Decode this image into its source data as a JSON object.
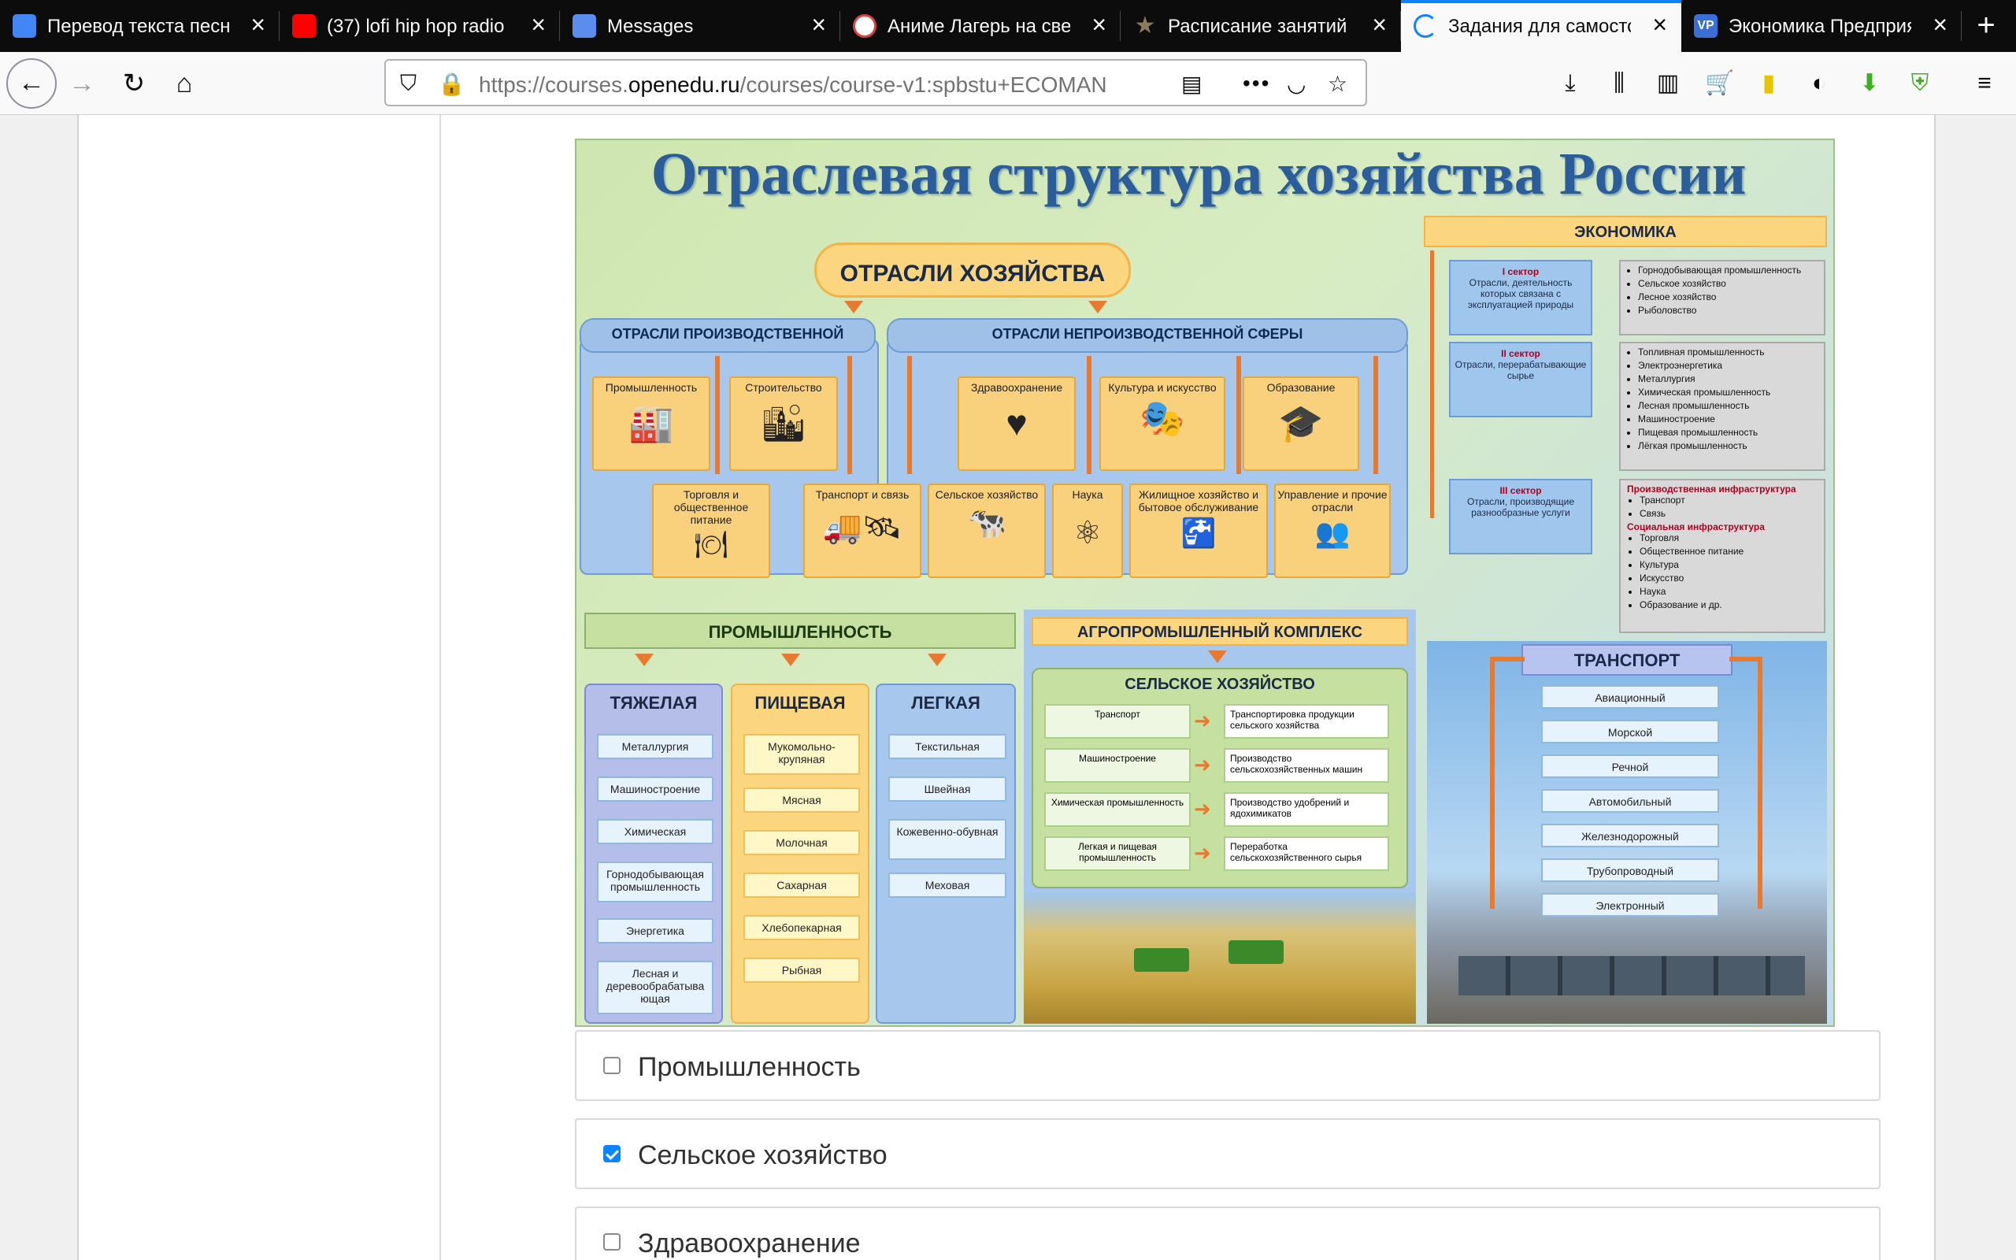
{
  "browser": {
    "tabs": [
      {
        "title": "Перевод текста песни",
        "icon": "docs-icon",
        "color": "#4285f4"
      },
      {
        "title": "(37) lofi hip hop radio",
        "icon": "youtube-icon",
        "color": "#ff0000"
      },
      {
        "title": "Messages",
        "icon": "messages-icon",
        "color": "#5b8def"
      },
      {
        "title": "Аниме Лагерь на свеж",
        "icon": "anime-icon",
        "color": "#e04040"
      },
      {
        "title": "Расписание занятий",
        "icon": "star-icon",
        "color": "#8a7b5a"
      },
      {
        "title": "Задания для самосто",
        "icon": "loading-icon",
        "color": "#0a84ff",
        "active": true
      },
      {
        "title": "Экономика Предприя",
        "icon": "vp-icon",
        "color": "#3a6fd8"
      }
    ],
    "url_prefix": "https://courses.",
    "url_domain": "openedu.ru",
    "url_rest": "/courses/course-v1:spbstu+ECOMAN"
  },
  "infographic": {
    "title": "Отраслевая структура хозяйства России",
    "main_node": "ОТРАСЛИ ХОЗЯЙСТВА",
    "prod_sphere": "ОТРАСЛИ ПРОИЗВОДСТВЕННОЙ",
    "nonprod_sphere": "ОТРАСЛИ НЕПРОИЗВОДСТВЕННОЙ СФЕРЫ",
    "branches_top": [
      "Промышленность",
      "Строительство",
      "Здравоохранение",
      "Культура и искусство",
      "Образование"
    ],
    "branches_bottom": [
      "Торговля и общественное питание",
      "Транспорт и связь",
      "Сельское хозяйство",
      "Наука",
      "Жилищное хозяйство и бытовое обслуживание",
      "Управление и прочие отрасли"
    ],
    "economy": {
      "title": "ЭКОНОМИКА",
      "sectors": [
        {
          "name": "I сектор",
          "desc": "Отрасли, деятельность которых связана с эксплуатацией природы",
          "items": [
            "Горнодобывающая промышленность",
            "Сельское хозяйство",
            "Лесное хозяйство",
            "Рыболовство"
          ]
        },
        {
          "name": "II сектор",
          "desc": "Отрасли, перерабатывающие сырье",
          "items": [
            "Топливная промышленность",
            "Электроэнергетика",
            "Металлургия",
            "Химическая промышленность",
            "Лесная промышленность",
            "Машиностроение",
            "Пищевая промышленность",
            "Лёгкая промышленность"
          ]
        },
        {
          "name": "III сектор",
          "desc": "Отрасли, производящие разнообразные услуги",
          "infra1": "Производственная инфраструктура",
          "items1": [
            "Транспорт",
            "Связь"
          ],
          "infra2": "Социальная инфраструктура",
          "items2": [
            "Торговля",
            "Общественное питание",
            "Культура",
            "Искусство",
            "Наука",
            "Образование и др."
          ]
        }
      ]
    },
    "industry": {
      "title": "ПРОМЫШЛЕННОСТЬ",
      "heavy": {
        "title": "ТЯЖЕЛАЯ",
        "items": [
          "Металлургия",
          "Машиностроение",
          "Химическая",
          "Горнодобывающая промышленность",
          "Энергетика",
          "Лесная и деревообрабатыва ющая"
        ]
      },
      "food": {
        "title": "ПИЩЕВАЯ",
        "items": [
          "Мукомольно-крупяная",
          "Мясная",
          "Молочная",
          "Сахарная",
          "Хлебопекарная",
          "Рыбная"
        ]
      },
      "light": {
        "title": "ЛЕГКАЯ",
        "items": [
          "Текстильная",
          "Швейная",
          "Кожевенно-обувная",
          "Меховая"
        ]
      }
    },
    "agro": {
      "title": "АГРОПРОМЫШЛЕННЫЙ КОМПЛЕКС",
      "sub": "СЕЛЬСКОЕ ХОЗЯЙСТВО",
      "rows": [
        {
          "left": "Транспорт",
          "right": "Транспортировка продукции сельского хозяйства"
        },
        {
          "left": "Машиностроение",
          "right": "Производство сельскохозяйственных машин"
        },
        {
          "left": "Химическая промышленность",
          "right": "Производство удобрений и ядохимикатов"
        },
        {
          "left": "Легкая и пищевая промышленность",
          "right": "Переработка сельскохозяйственного сырья"
        }
      ]
    },
    "transport": {
      "title": "ТРАНСПОРТ",
      "items": [
        "Авиационный",
        "Морской",
        "Речной",
        "Автомобильный",
        "Железнодорожный",
        "Трубопроводный",
        "Электронный"
      ]
    }
  },
  "answers": [
    {
      "label": "Промышленность",
      "checked": false
    },
    {
      "label": "Сельское хозяйство",
      "checked": true
    },
    {
      "label": "Здравоохранение",
      "checked": false
    }
  ]
}
